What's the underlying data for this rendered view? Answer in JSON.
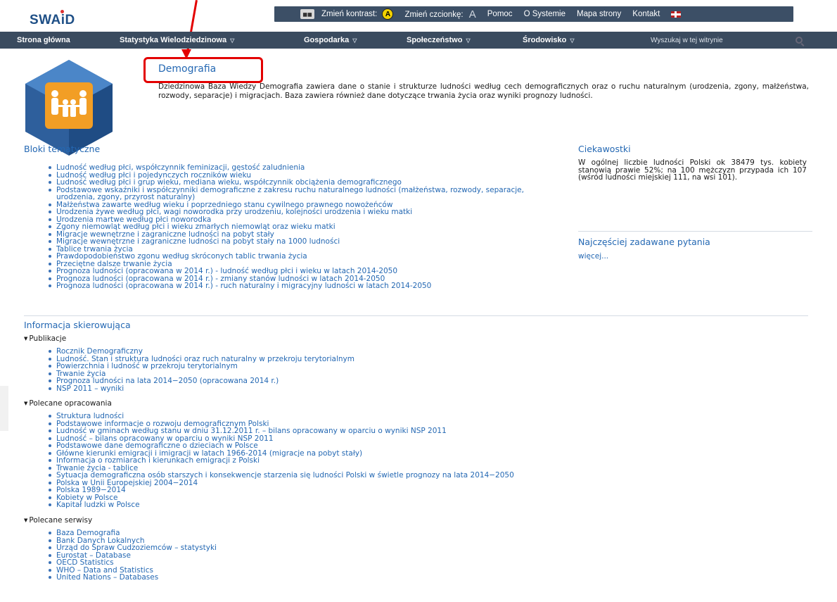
{
  "header": {
    "logo_text": "SWAiD",
    "utility": {
      "contrast_label": "Zmień kontrast:",
      "contrast_badge": "A",
      "font_label": "Zmień czcionkę:",
      "font_badge": "A",
      "help": "Pomoc",
      "about": "O Systemie",
      "sitemap": "Mapa strony",
      "contact": "Kontakt"
    }
  },
  "nav": {
    "items": [
      {
        "label": "Strona główna",
        "caret": false
      },
      {
        "label": "Statystyka Wielodziedzinowa",
        "caret": true
      },
      {
        "label": "Gospodarka",
        "caret": true
      },
      {
        "label": "Społeczeństwo",
        "caret": true
      },
      {
        "label": "Środowisko",
        "caret": true
      }
    ],
    "search_placeholder": "Wyszukaj w tej witrynie"
  },
  "hero": {
    "title": "Demografia",
    "description": "Dziedzinowa Baza Wiedzy Demografia zawiera dane o stanie i strukturze ludności według cech demograficznych oraz o ruchu naturalnym (urodzenia, zgony, małżeństwa, rozwody, separacje) i migracjach. Baza zawiera również dane dotyczące trwania życia oraz wyniki prognozy ludności."
  },
  "blocks": {
    "heading": "Bloki tematyczne",
    "items": [
      "Ludność według płci, współczynnik feminizacji, gęstość zaludnienia",
      "Ludność według płci i pojedynczych roczników wieku",
      "Ludność według płci i grup wieku, mediana wieku, współczynnik obciążenia demograficznego",
      "Podstawowe wskaźniki i współczynniki demograficzne z zakresu ruchu naturalnego ludności (małżeństwa, rozwody, separacje, urodzenia, zgony, przyrost naturalny)",
      "Małżeństwa zawarte według wieku i poprzedniego stanu cywilnego prawnego nowożeńców",
      "Urodzenia żywe według płci, wagi noworodka przy urodzeniu, kolejności urodzenia i wieku matki",
      "Urodzenia martwe według płci noworodka",
      "Zgony niemowląt według płci i wieku zmarłych niemowląt oraz wieku matki",
      "Migracje wewnętrzne i zagraniczne ludności na pobyt stały",
      "Migracje wewnętrzne i zagraniczne ludności na pobyt stały na 1000 ludności",
      "Tablice trwania życia",
      "Prawdopodobieństwo zgonu według skróconych tablic trwania życia",
      "Przeciętne dalsze trwanie życia",
      "Prognoza ludności (opracowana w 2014 r.) - ludność według płci i wieku w latach 2014-2050",
      "Prognoza ludności (opracowana w 2014 r.) - zmiany stanów ludności w latach 2014-2050",
      "Prognoza ludności (opracowana w 2014 r.) - ruch naturalny i migracyjny ludności w latach 2014-2050"
    ]
  },
  "sidebar": {
    "facts_heading": "Ciekawostki",
    "facts_text": "W ogólnej liczbie ludności Polski ok 38479 tys. kobiety stanowią prawie 52%; na 100 mężczyzn przypada ich 107 (wśród ludności miejskiej 111, na wsi 101).",
    "faq_heading": "Najczęściej zadawane pytania",
    "more_link": "więcej..."
  },
  "info": {
    "heading": "Informacja skierowująca",
    "groups": [
      {
        "label": "Publikacje",
        "items": [
          "Rocznik Demograficzny",
          "Ludność. Stan i struktura ludności oraz ruch naturalny w przekroju terytorialnym",
          "Powierzchnia i ludność w przekroju terytorialnym",
          "Trwanie życia",
          "Prognoza ludności na lata 2014−2050 (opracowana 2014 r.)",
          "NSP 2011 – wyniki"
        ]
      },
      {
        "label": "Polecane opracowania",
        "items": [
          "Struktura ludności",
          "Podstawowe informacje o rozwoju demograficznym Polski",
          "Ludność w gminach według stanu w dniu 31.12.2011 r. – bilans opracowany w oparciu o wyniki NSP 2011",
          "Ludność – bilans opracowany w oparciu o wyniki NSP 2011",
          "Podstawowe dane demograficzne o dzieciach w Polsce",
          "Główne kierunki emigracji i imigracji w latach 1966-2014 (migracje na pobyt stały)",
          "Informacja o rozmiarach i kierunkach emigracji z Polski",
          "Trwanie życia - tablice",
          "Sytuacja demograficzna osób starszych i konsekwencje starzenia się ludności Polski w świetle prognozy na lata 2014−2050",
          "Polska w Unii Europejskiej 2004−2014",
          "Polska 1989−2014",
          "Kobiety w Polsce",
          "Kapitał ludzki w Polsce"
        ]
      },
      {
        "label": "Polecane serwisy",
        "items": [
          "Baza Demografia",
          "Bank Danych Lokalnych",
          "Urząd do Spraw Cudzoziemców – statystyki",
          "Eurostat – Database",
          "OECD Statistics",
          "WHO – Data and Statistics",
          "United Nations – Databases"
        ]
      }
    ]
  },
  "colors": {
    "accent": "#2468b3",
    "nav_bg": "#3a4b5f",
    "annotation": "#e30000"
  }
}
